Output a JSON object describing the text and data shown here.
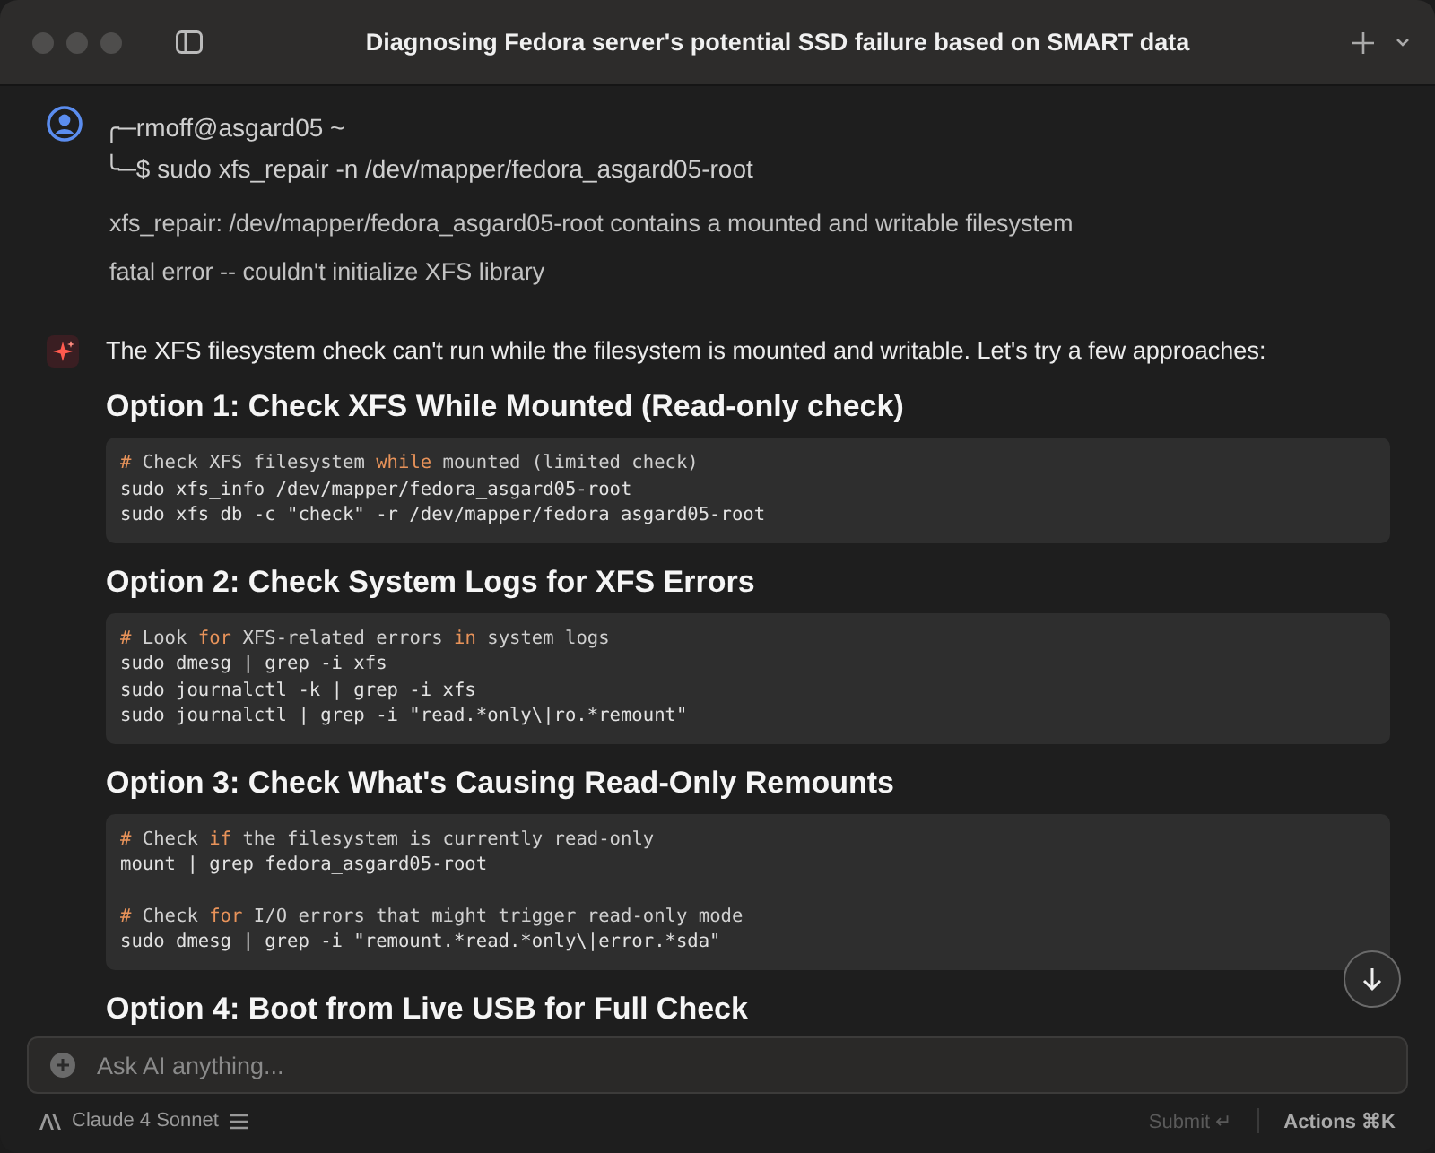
{
  "window": {
    "title": "Diagnosing Fedora server's potential SSD failure based on SMART data"
  },
  "user_message": {
    "prompt_lines": [
      "╭─rmoff@asgard05 ~",
      "╰─$ sudo xfs_repair -n /dev/mapper/fedora_asgard05-root"
    ],
    "output_lines": [
      "xfs_repair: /dev/mapper/fedora_asgard05-root contains a mounted and writable filesystem",
      "fatal error -- couldn't initialize XFS library"
    ]
  },
  "assistant_message": {
    "intro": "The XFS filesystem check can't run while the filesystem is mounted and writable. Let's try a few approaches:",
    "sections": [
      {
        "heading": "Option 1: Check XFS While Mounted (Read-only check)",
        "code_groups": [
          [
            [
              {
                "kind": "hash",
                "text": "# "
              },
              {
                "kind": "comment",
                "text": "Check XFS filesystem "
              },
              {
                "kind": "keyword",
                "text": "while"
              },
              {
                "kind": "comment",
                "text": " mounted (limited check)"
              }
            ],
            [
              {
                "kind": "plain",
                "text": "sudo xfs_info /dev/mapper/fedora_asgard05-root"
              }
            ],
            [
              {
                "kind": "plain",
                "text": "sudo xfs_db -c \"check\" -r /dev/mapper/fedora_asgard05-root"
              }
            ]
          ]
        ]
      },
      {
        "heading": "Option 2: Check System Logs for XFS Errors",
        "code_groups": [
          [
            [
              {
                "kind": "hash",
                "text": "# "
              },
              {
                "kind": "comment",
                "text": "Look "
              },
              {
                "kind": "keyword",
                "text": "for"
              },
              {
                "kind": "comment",
                "text": " XFS-related errors "
              },
              {
                "kind": "keyword",
                "text": "in"
              },
              {
                "kind": "comment",
                "text": " system logs"
              }
            ],
            [
              {
                "kind": "plain",
                "text": "sudo dmesg | grep -i xfs"
              }
            ],
            [
              {
                "kind": "plain",
                "text": "sudo journalctl -k | grep -i xfs"
              }
            ],
            [
              {
                "kind": "plain",
                "text": "sudo journalctl | grep -i \"read.*only\\|ro.*remount\""
              }
            ]
          ]
        ]
      },
      {
        "heading": "Option 3: Check What's Causing Read-Only Remounts",
        "code_groups": [
          [
            [
              {
                "kind": "hash",
                "text": "# "
              },
              {
                "kind": "comment",
                "text": "Check "
              },
              {
                "kind": "keyword",
                "text": "if"
              },
              {
                "kind": "comment",
                "text": " the filesystem is currently read-only"
              }
            ],
            [
              {
                "kind": "plain",
                "text": "mount | grep fedora_asgard05-root"
              }
            ]
          ],
          [
            [
              {
                "kind": "hash",
                "text": "# "
              },
              {
                "kind": "comment",
                "text": "Check "
              },
              {
                "kind": "keyword",
                "text": "for"
              },
              {
                "kind": "comment",
                "text": " I/O errors that might trigger read-only mode"
              }
            ],
            [
              {
                "kind": "plain",
                "text": "sudo dmesg | grep -i \"remount.*read.*only\\|error.*sda\""
              }
            ]
          ]
        ]
      },
      {
        "heading": "Option 4: Boot from Live USB for Full Check"
      }
    ]
  },
  "composer": {
    "placeholder": "Ask AI anything..."
  },
  "footer": {
    "model": "Claude 4 Sonnet",
    "submit": "Submit ↵",
    "actions": "Actions ⌘K"
  }
}
